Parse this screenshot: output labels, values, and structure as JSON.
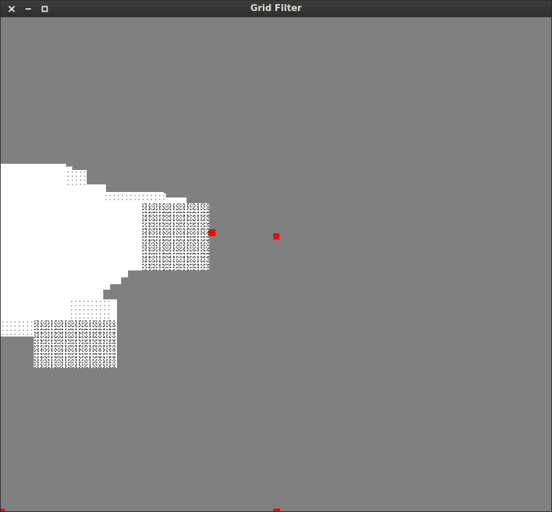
{
  "window": {
    "title": "Grid Filter",
    "controls": {
      "close": "close-icon",
      "minimize": "minimize-icon",
      "maximize": "maximize-icon"
    }
  },
  "canvas": {
    "background_color": "#808080",
    "occupancy_color": "#ffffff",
    "marker_color": "#ff0000",
    "marker_count": 4
  }
}
